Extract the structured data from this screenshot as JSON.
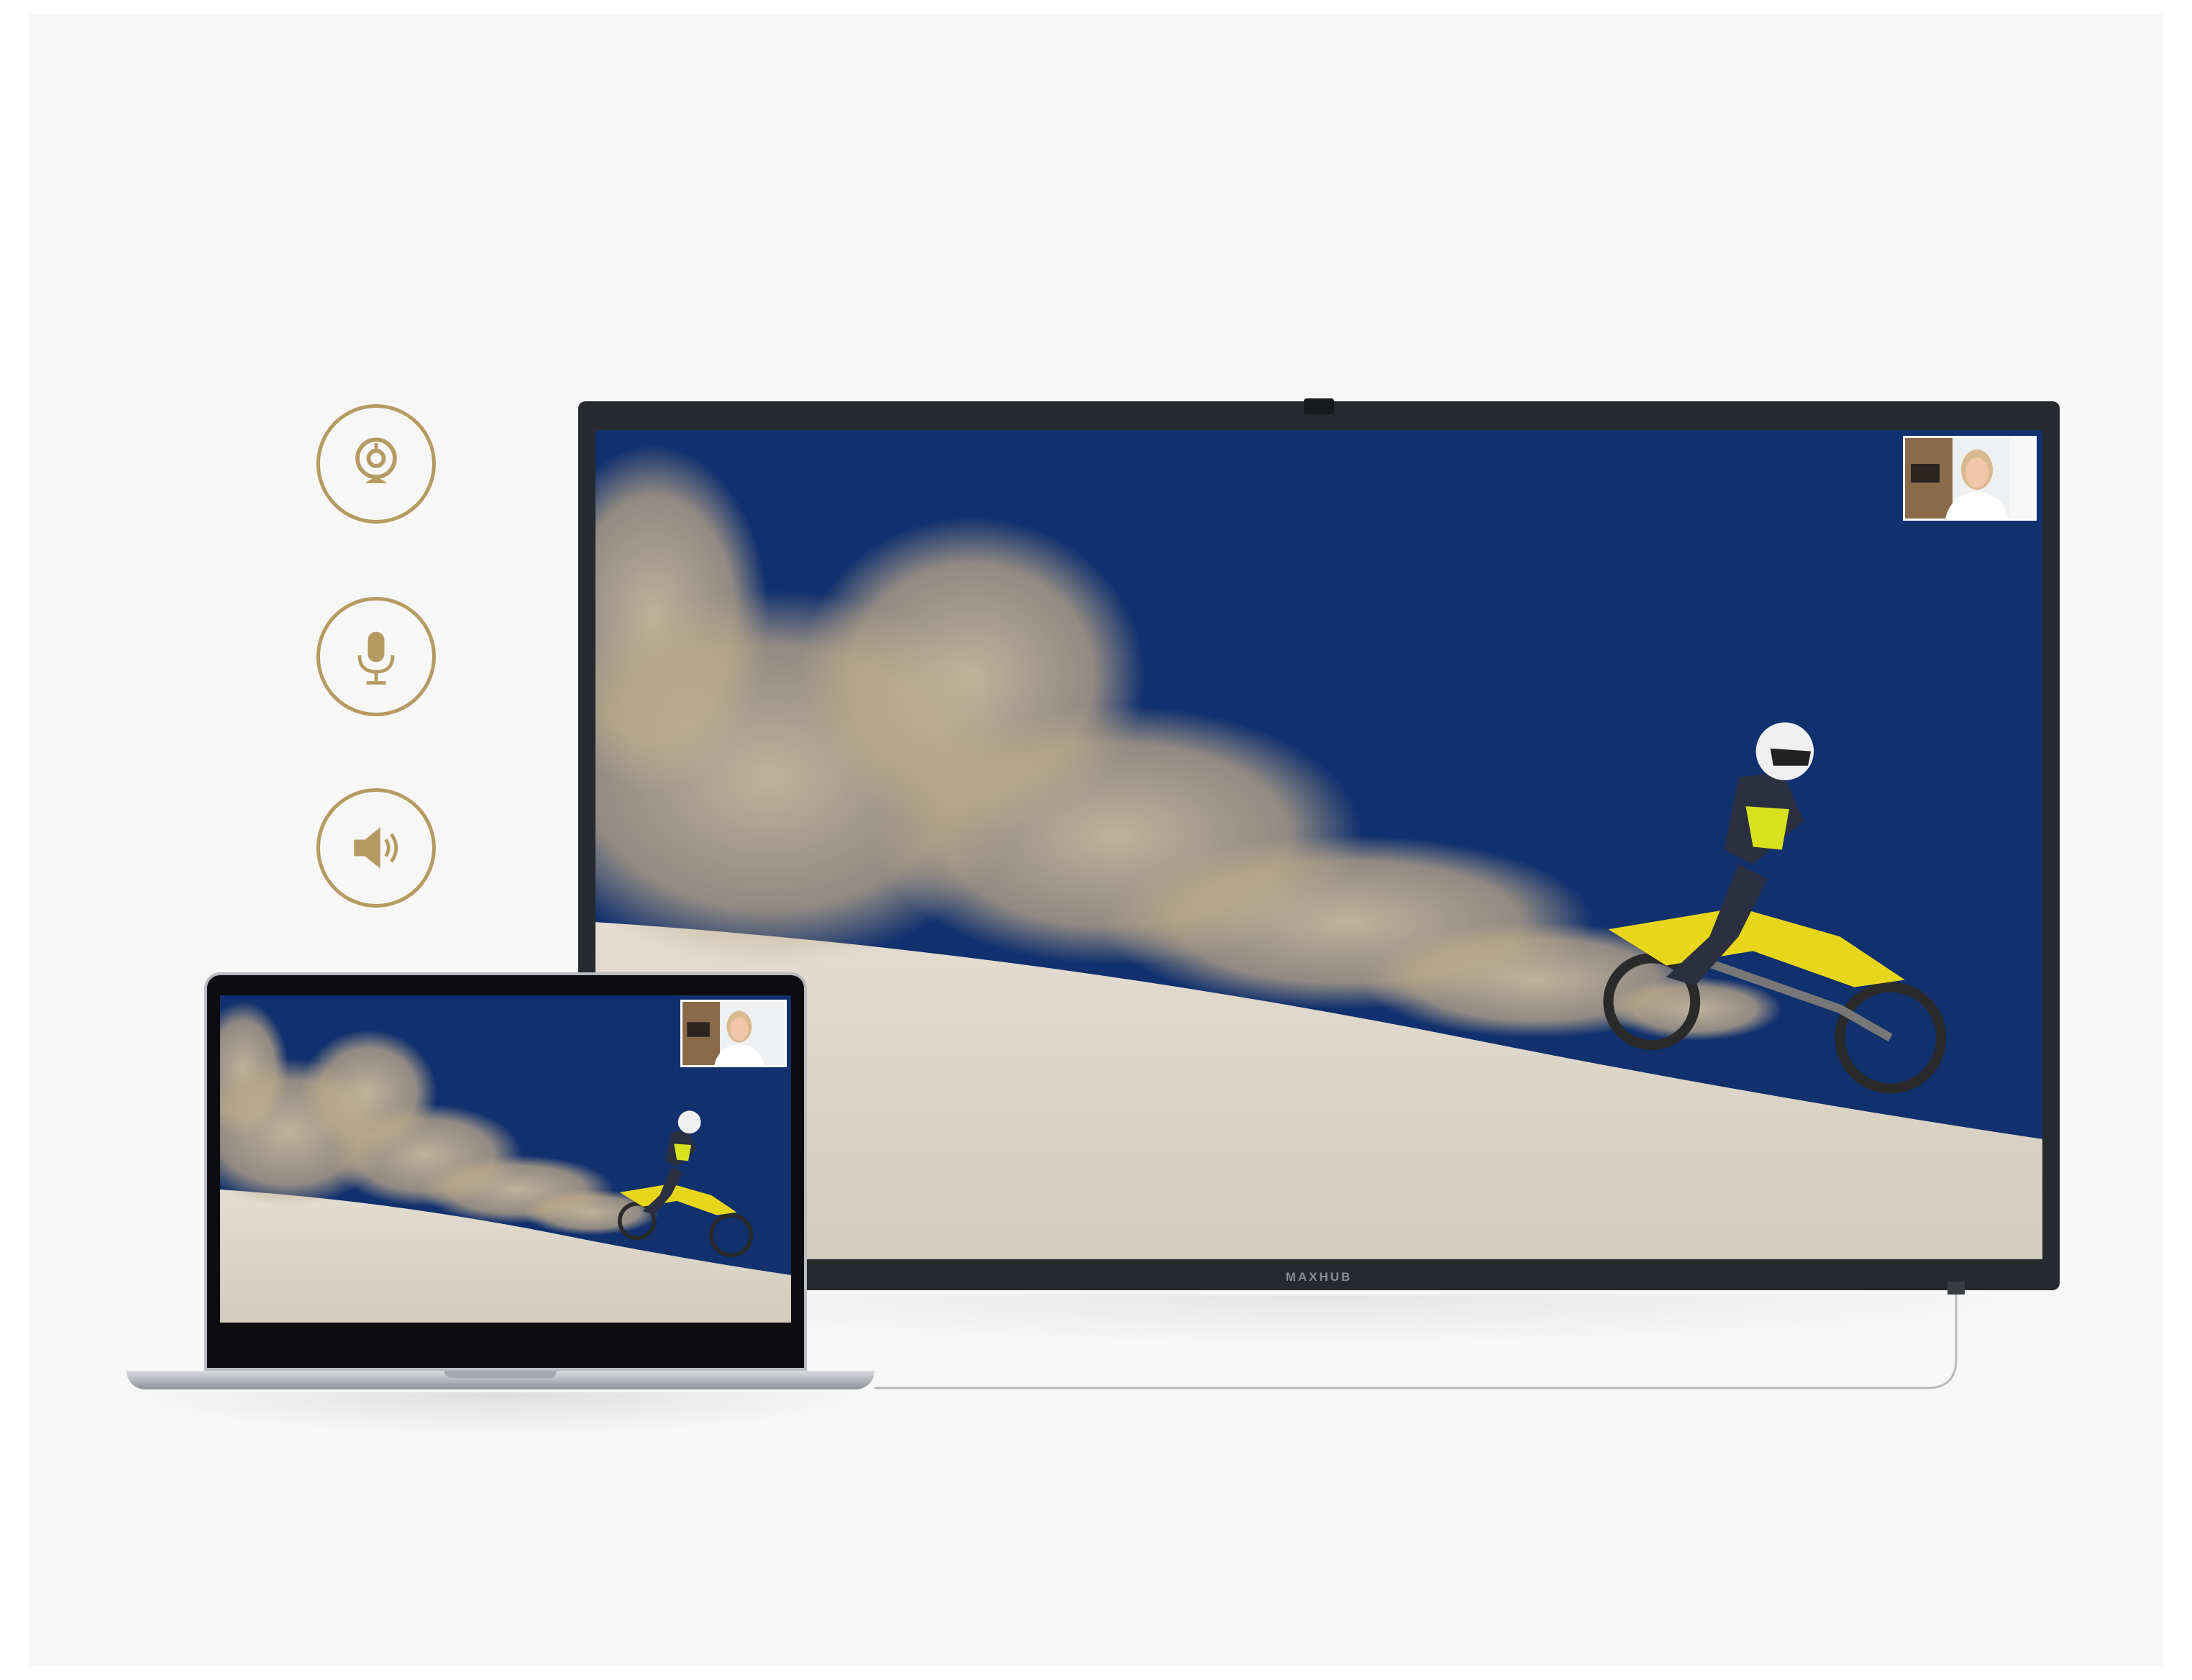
{
  "tv": {
    "brand": "MAXHUB"
  },
  "icons": {
    "camera": "webcam-icon",
    "microphone": "microphone-icon",
    "speaker": "speaker-icon"
  },
  "colors": {
    "accent_gold": "#b59b62",
    "sky_blue": "#10306e",
    "sand": "#ddd6c9",
    "bike_yellow": "#e8d61a"
  }
}
